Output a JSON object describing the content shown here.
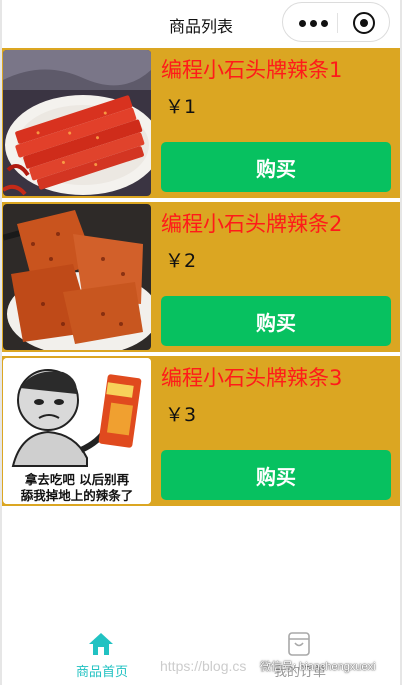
{
  "navbar": {
    "title": "商品列表",
    "more_icon": "more-dots-icon",
    "close_icon": "target-icon"
  },
  "products": [
    {
      "name": "编程小石头牌辣条1",
      "price": "￥1",
      "buy_label": "购买",
      "image": "spicy-strips-plate"
    },
    {
      "name": "编程小石头牌辣条2",
      "price": "￥2",
      "buy_label": "购买",
      "image": "spicy-slices-plate"
    },
    {
      "name": "编程小石头牌辣条3",
      "price": "￥3",
      "buy_label": "购买",
      "image": "meme-cartoon"
    }
  ],
  "meme_text": {
    "line1": "拿去吃吧  以后别再",
    "line2": "舔我掉地上的辣条了"
  },
  "tabbar": {
    "home_label": "商品首页",
    "orders_label": "我的订单",
    "home_icon": "home-icon",
    "orders_icon": "bag-icon"
  },
  "watermark": {
    "url": "https://blog.cs",
    "wechat": "微信号: bianchengxuexi"
  },
  "colors": {
    "card_bg": "#dba622",
    "name_text": "#ff1a1a",
    "buy_button": "#07c160",
    "tab_active": "#21c2c2"
  }
}
